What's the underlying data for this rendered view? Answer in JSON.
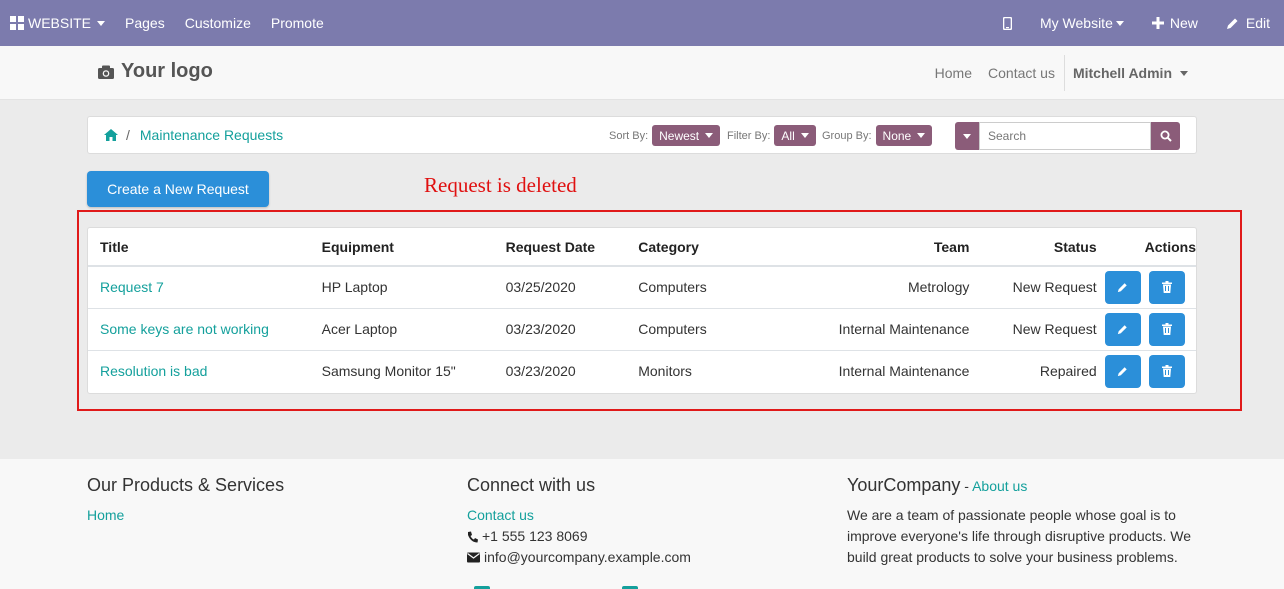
{
  "adminbar": {
    "website_label": "WEBSITE",
    "menu": [
      "Pages",
      "Customize",
      "Promote"
    ],
    "my_website": "My Website",
    "new_label": "New",
    "edit_label": "Edit",
    "color": "#7c7bad"
  },
  "header": {
    "logo_text": "Your logo",
    "nav": [
      "Home",
      "Contact us"
    ],
    "user": "Mitchell Admin"
  },
  "breadcrumb": {
    "current": "Maintenance Requests"
  },
  "filters": {
    "sort_label": "Sort By:",
    "sort_value": "Newest",
    "filter_label": "Filter By:",
    "filter_value": "All",
    "group_label": "Group By:",
    "group_value": "None",
    "accent": "#8b5c79"
  },
  "search": {
    "placeholder": "Search"
  },
  "new_request_label": "Create a New Request",
  "annotation": "Request is deleted",
  "table": {
    "headers": [
      "Title",
      "Equipment",
      "Request Date",
      "Category",
      "Team",
      "Status",
      "Actions"
    ],
    "rows": [
      [
        "Request 7",
        "HP Laptop",
        "03/25/2020",
        "Computers",
        "Metrology",
        "New Request"
      ],
      [
        "Some keys are not working",
        "Acer Laptop",
        "03/23/2020",
        "Computers",
        "Internal Maintenance",
        "New Request"
      ],
      [
        "Resolution is bad",
        "Samsung Monitor 15\"",
        "03/23/2020",
        "Monitors",
        "Internal Maintenance",
        "Repaired"
      ]
    ]
  },
  "footer": {
    "col1_title": "Our Products & Services",
    "col1_link": "Home",
    "col2_title": "Connect with us",
    "col2_link": "Contact us",
    "phone": "+1 555 123 8069",
    "email": "info@yourcompany.example.com",
    "col3_company": "YourCompany",
    "col3_dash": " - ",
    "col3_link": "About us",
    "col3_text": "We are a team of passionate people whose goal is to improve everyone's life through disruptive products. We build great products to solve your business problems."
  }
}
